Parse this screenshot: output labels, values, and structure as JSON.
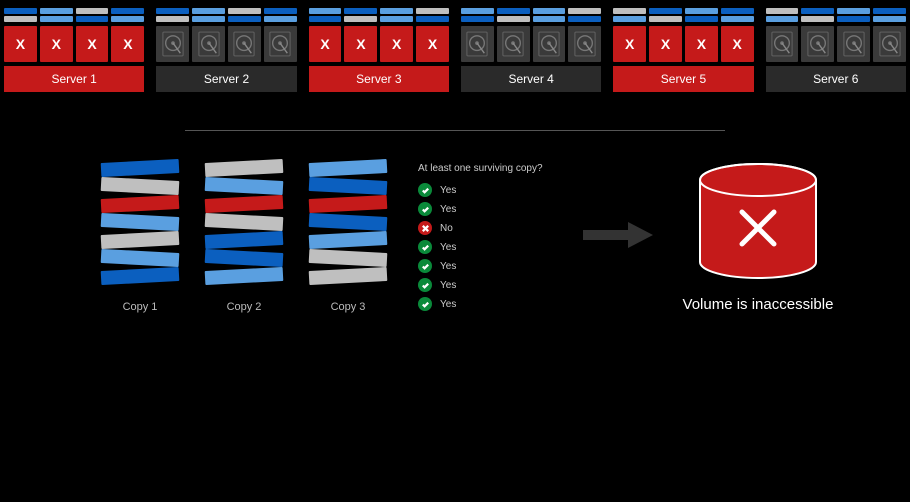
{
  "colors": {
    "blue": "#0b5fbf",
    "lblue": "#5a9fe0",
    "grey": "#bfbfbf",
    "red": "#c51a1a",
    "ok_green": "#0a8a3a"
  },
  "servers": [
    {
      "name": "Server 1",
      "failed": true,
      "stripes": [
        [
          "blue",
          "lblue",
          "grey",
          "blue"
        ],
        [
          "grey",
          "lblue",
          "blue",
          "lblue"
        ]
      ]
    },
    {
      "name": "Server 2",
      "failed": false,
      "stripes": [
        [
          "blue",
          "lblue",
          "grey",
          "blue"
        ],
        [
          "grey",
          "lblue",
          "blue",
          "lblue"
        ]
      ]
    },
    {
      "name": "Server 3",
      "failed": true,
      "stripes": [
        [
          "lblue",
          "blue",
          "lblue",
          "grey"
        ],
        [
          "blue",
          "grey",
          "lblue",
          "blue"
        ]
      ]
    },
    {
      "name": "Server 4",
      "failed": false,
      "stripes": [
        [
          "lblue",
          "blue",
          "lblue",
          "grey"
        ],
        [
          "blue",
          "grey",
          "lblue",
          "blue"
        ]
      ]
    },
    {
      "name": "Server 5",
      "failed": true,
      "stripes": [
        [
          "grey",
          "blue",
          "lblue",
          "blue"
        ],
        [
          "lblue",
          "grey",
          "blue",
          "lblue"
        ]
      ]
    },
    {
      "name": "Server 6",
      "failed": false,
      "stripes": [
        [
          "grey",
          "blue",
          "lblue",
          "blue"
        ],
        [
          "lblue",
          "grey",
          "blue",
          "lblue"
        ]
      ]
    }
  ],
  "failed_drive_mark": "X",
  "copies_title": "At least one surviving copy?",
  "copies": [
    {
      "label": "Copy 1",
      "slabs": [
        "blue",
        "grey",
        "red",
        "lblue",
        "grey",
        "lblue",
        "blue"
      ]
    },
    {
      "label": "Copy 2",
      "slabs": [
        "grey",
        "lblue",
        "red",
        "grey",
        "blue",
        "blue",
        "lblue"
      ]
    },
    {
      "label": "Copy 3",
      "slabs": [
        "lblue",
        "blue",
        "red",
        "blue",
        "lblue",
        "grey",
        "grey"
      ]
    }
  ],
  "checks": [
    {
      "survives": true,
      "label": "Yes"
    },
    {
      "survives": true,
      "label": "Yes"
    },
    {
      "survives": false,
      "label": "No"
    },
    {
      "survives": true,
      "label": "Yes"
    },
    {
      "survives": true,
      "label": "Yes"
    },
    {
      "survives": true,
      "label": "Yes"
    },
    {
      "survives": true,
      "label": "Yes"
    }
  ],
  "result_label": "Volume is inaccessible"
}
